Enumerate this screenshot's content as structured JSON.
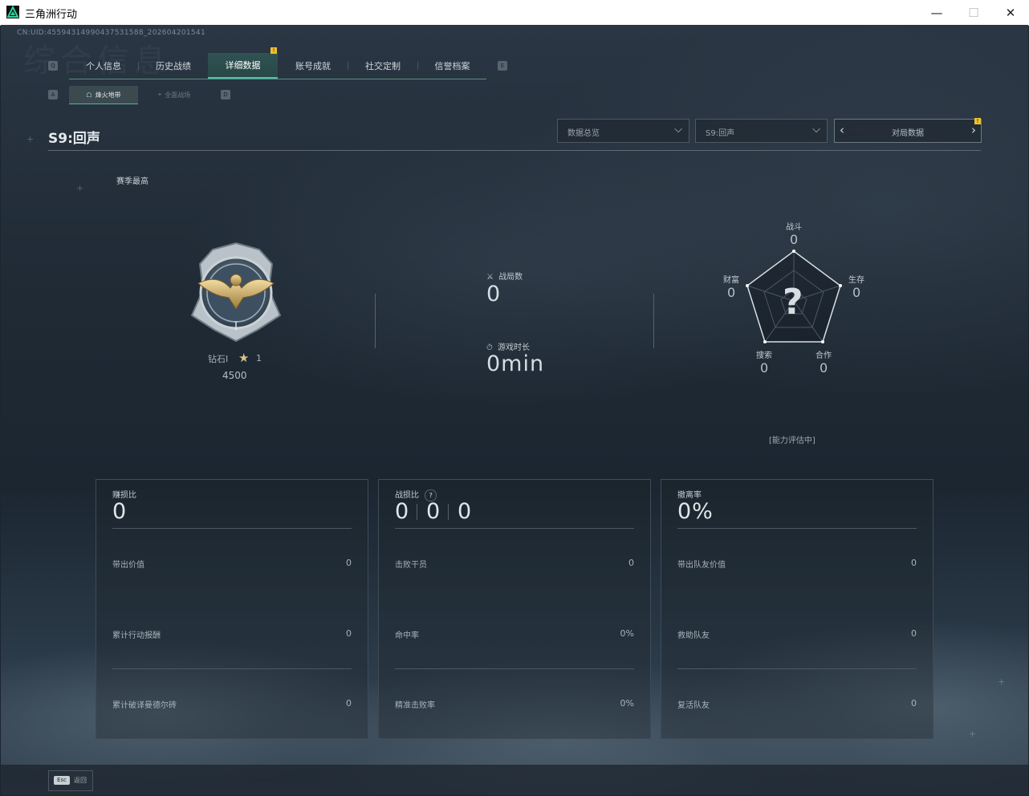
{
  "window": {
    "title": "三角洲行动",
    "controls": {
      "minimize": "—",
      "maximize": "☐",
      "close": "✕"
    }
  },
  "header": {
    "uid": "CN:UID:455943149904375315​88_202604201541",
    "bg_watermark": "综合信息"
  },
  "nav": {
    "key_left": "Q",
    "key_right": "E",
    "tabs": [
      {
        "label": "个人信息",
        "active": false
      },
      {
        "label": "历史战绩",
        "active": false
      },
      {
        "label": "详细数据",
        "active": true,
        "badge": "!"
      },
      {
        "label": "账号成就",
        "active": false
      },
      {
        "label": "社交定制",
        "active": false
      },
      {
        "label": "信誉档案",
        "active": false
      }
    ]
  },
  "subnav": {
    "key_left": "A",
    "key_right": "D",
    "tabs": [
      {
        "label": "烽火地带",
        "active": true,
        "icon": "helmet-icon"
      },
      {
        "label": "全面战场",
        "active": false,
        "icon": "crosshair-icon"
      }
    ]
  },
  "season": {
    "title": "S9:回声"
  },
  "filters": {
    "overview": "数据总览",
    "season": "S9:回声",
    "match_data": "对局数据",
    "match_badge": "!"
  },
  "rank": {
    "season_best_label": "赛季最高",
    "name": "钻石I",
    "stars": "1",
    "score": "4500"
  },
  "summary": {
    "matches_label": "战局数",
    "matches": "0",
    "playtime_label": "游戏时长",
    "playtime": "0min"
  },
  "radar": {
    "placeholder": "?",
    "axes": [
      {
        "label": "战斗",
        "value": "0"
      },
      {
        "label": "生存",
        "value": "0"
      },
      {
        "label": "合作",
        "value": "0"
      },
      {
        "label": "搜索",
        "value": "0"
      },
      {
        "label": "财富",
        "value": "0"
      }
    ],
    "status": "[能力评估中]"
  },
  "cards": [
    {
      "label": "赚损比",
      "value": "0",
      "rows": [
        {
          "label": "带出价值",
          "value": "0"
        },
        {
          "label": "累计行动报酬",
          "value": "0"
        },
        {
          "label": "累计破译曼德尔砖",
          "value": "0"
        }
      ]
    },
    {
      "label": "战损比",
      "help": "?",
      "values": [
        "0",
        "0",
        "0"
      ],
      "rows": [
        {
          "label": "击败干员",
          "value": "0"
        },
        {
          "label": "命中率",
          "value": "0%"
        },
        {
          "label": "精准击败率",
          "value": "0%"
        }
      ]
    },
    {
      "label": "撤离率",
      "value": "0%",
      "rows": [
        {
          "label": "带出队友价值",
          "value": "0"
        },
        {
          "label": "救助队友",
          "value": "0"
        },
        {
          "label": "复活队友",
          "value": "0"
        }
      ]
    }
  ],
  "footer": {
    "esc_key": "Esc",
    "esc_label": "返回"
  },
  "colors": {
    "accent": "#4fc0ad",
    "badge": "#f0c030",
    "panel_border": "#3f4b56"
  }
}
